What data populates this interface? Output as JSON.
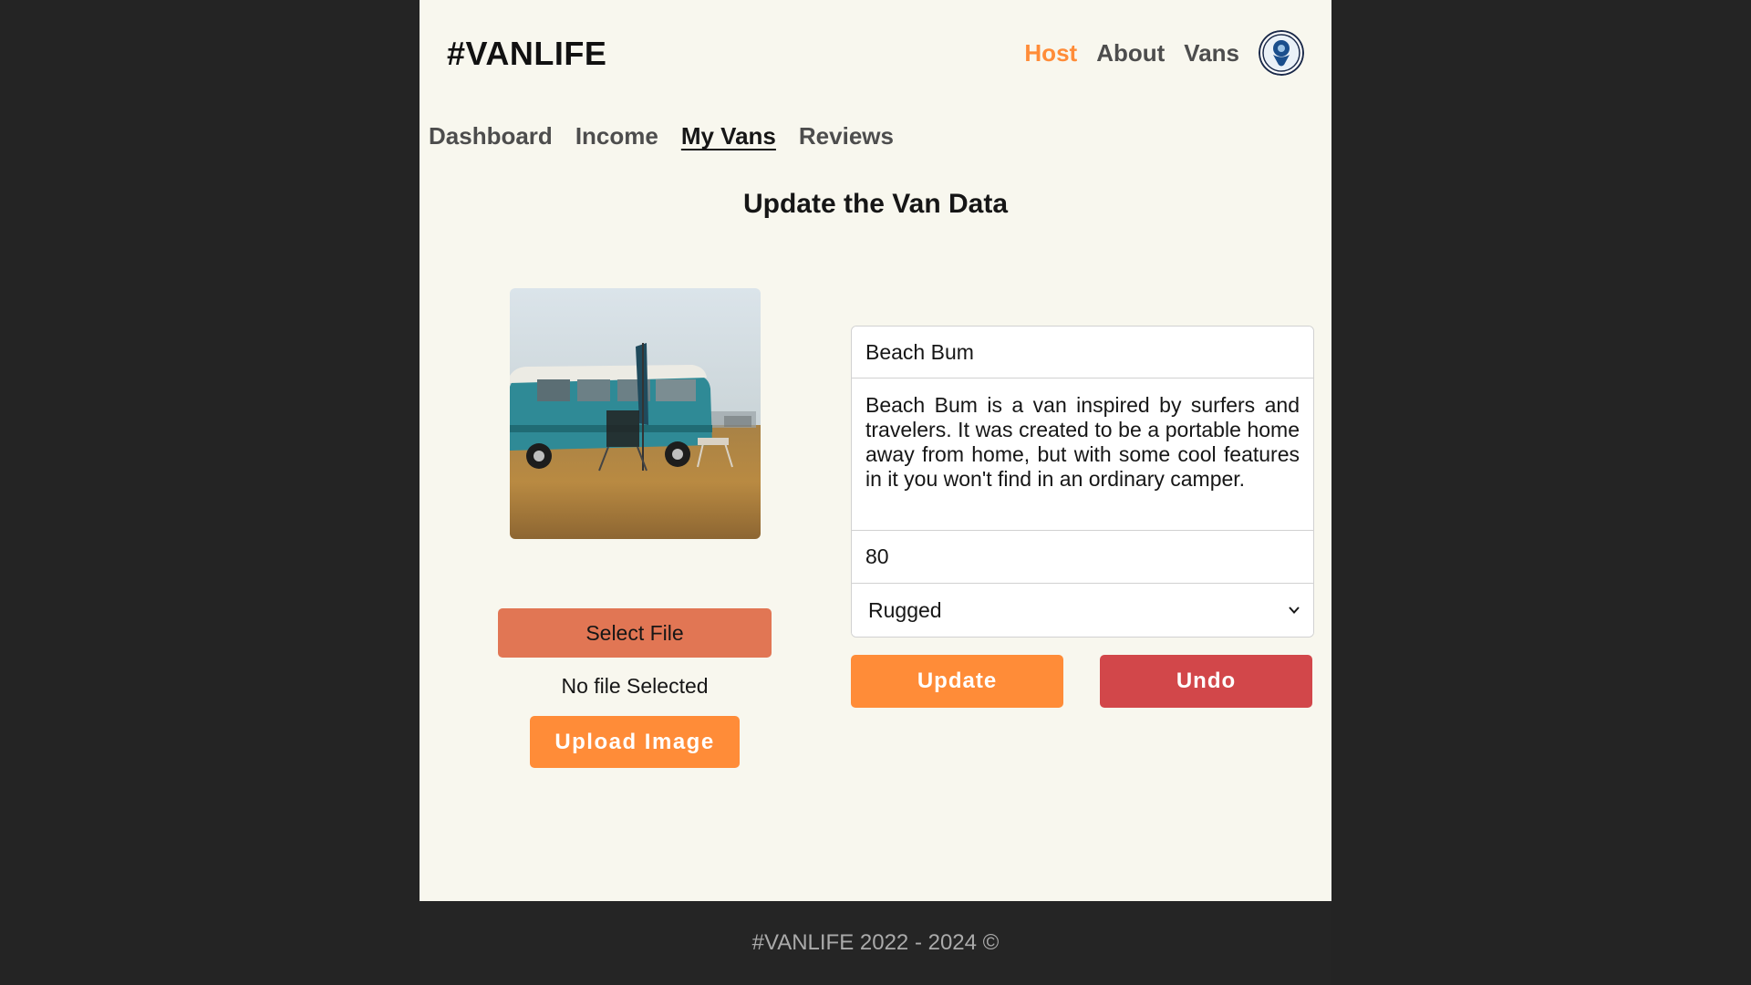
{
  "header": {
    "logo": "#VANLIFE",
    "nav": [
      {
        "label": "Host",
        "active": true
      },
      {
        "label": "About",
        "active": false
      },
      {
        "label": "Vans",
        "active": false
      }
    ],
    "avatar_icon": "user-avatar-icon"
  },
  "host_nav": [
    {
      "label": "Dashboard",
      "active": false
    },
    {
      "label": "Income",
      "active": false
    },
    {
      "label": "My Vans",
      "active": true
    },
    {
      "label": "Reviews",
      "active": false
    }
  ],
  "page": {
    "title": "Update the Van Data"
  },
  "image_panel": {
    "select_file_label": "Select File",
    "file_status": "No file Selected",
    "upload_label": "Upload Image"
  },
  "form": {
    "name": "Beach Bum",
    "description": "Beach Bum is a van inspired by surfers and travelers. It was created to be a portable home away from home, but with some cool features in it you won't find in an ordinary camper.",
    "price": "80",
    "type": "Rugged",
    "update_label": "Update",
    "undo_label": "Undo"
  },
  "footer": {
    "text": "#VANLIFE 2022 - 2024 ©"
  },
  "colors": {
    "accent": "#ff8c38",
    "select_file": "#e17654",
    "undo": "#d2474a",
    "page_bg": "#f8f7ee",
    "outer_bg": "#242424"
  }
}
